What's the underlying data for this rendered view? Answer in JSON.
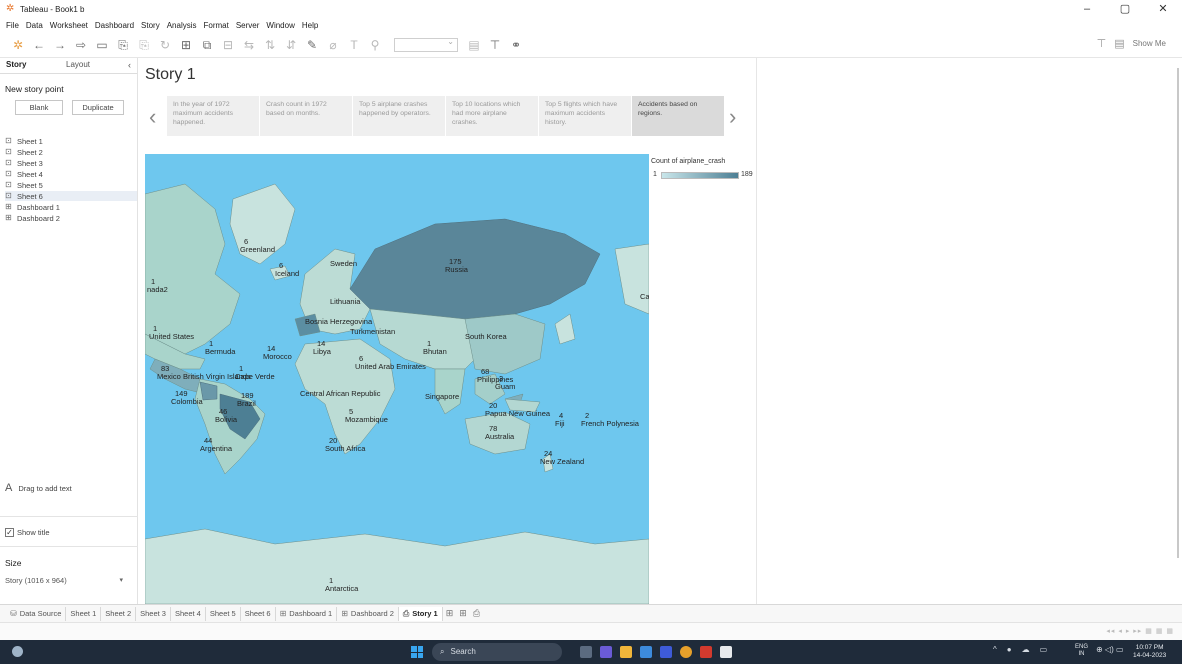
{
  "window": {
    "title": "Tableau - Book1 b",
    "controls": [
      "–",
      "▢",
      "✕"
    ]
  },
  "menu": [
    "File",
    "Data",
    "Worksheet",
    "Dashboard",
    "Story",
    "Analysis",
    "Format",
    "Server",
    "Window",
    "Help"
  ],
  "toolbar": {
    "show_me": "Show Me"
  },
  "left_panel": {
    "tabs": [
      "Story",
      "Layout"
    ],
    "new_story_point": "New story point",
    "blank_button": "Blank",
    "duplicate_button": "Duplicate",
    "sheets": [
      "Sheet 1",
      "Sheet 2",
      "Sheet 3",
      "Sheet 4",
      "Sheet 5",
      "Sheet 6",
      "Dashboard 1",
      "Dashboard 2"
    ],
    "drag_text": "Drag to add text",
    "show_title": "Show title",
    "size_heading": "Size",
    "size_value": "Story (1016 x 964)"
  },
  "story": {
    "title": "Story 1",
    "points": [
      "In the year of 1972 maximum accidents happened.",
      "Crash count in 1972 based on months.",
      "Top 5 airplane crashes happened by operators.",
      "Top 10 locations which had more airplane crashes.",
      "Top 5 flights which have maximum accidents history.",
      "Accidents based on regions."
    ],
    "active_point": 5
  },
  "legend": {
    "title": "Count of airplane_crash",
    "min": "1",
    "max": "189",
    "color_low": "#c9e6ea",
    "color_high": "#4d7f94"
  },
  "map_labels": [
    {
      "name": "Greenland",
      "count": "6"
    },
    {
      "name": "Iceland",
      "count": "6"
    },
    {
      "name": "Sweden",
      "count": ""
    },
    {
      "name": "Russia",
      "count": "175"
    },
    {
      "name": "nada2",
      "count": "1"
    },
    {
      "name": "Lithuania",
      "count": ""
    },
    {
      "name": "Bosnia Herzegovina",
      "count": ""
    },
    {
      "name": "Turkmenistan",
      "count": ""
    },
    {
      "name": "South Korea",
      "count": ""
    },
    {
      "name": "United States",
      "count": "1"
    },
    {
      "name": "Bermuda",
      "count": "1"
    },
    {
      "name": "Morocco",
      "count": "14"
    },
    {
      "name": "Libya",
      "count": "14"
    },
    {
      "name": "United Arab Emirates",
      "count": "6"
    },
    {
      "name": "Bhutan",
      "count": "1"
    },
    {
      "name": "Mexico",
      "count": "83"
    },
    {
      "name": "British Virgin Islands",
      "count": ""
    },
    {
      "name": "Cape Verde",
      "count": "1"
    },
    {
      "name": "Philippines",
      "count": "68"
    },
    {
      "name": "Guam",
      "count": "3"
    },
    {
      "name": "Colombia",
      "count": "149"
    },
    {
      "name": "Central African Republic",
      "count": ""
    },
    {
      "name": "Singapore",
      "count": ""
    },
    {
      "name": "Papua New Guinea",
      "count": "20"
    },
    {
      "name": "Brazil",
      "count": "189"
    },
    {
      "name": "Bolivia",
      "count": "46"
    },
    {
      "name": "Mozambique",
      "count": "5"
    },
    {
      "name": "Fiji",
      "count": "4"
    },
    {
      "name": "French Polynesia",
      "count": "2"
    },
    {
      "name": "Australia",
      "count": "78"
    },
    {
      "name": "Argentina",
      "count": "44"
    },
    {
      "name": "South Africa",
      "count": "20"
    },
    {
      "name": "New Zealand",
      "count": "24"
    },
    {
      "name": "Antarctica",
      "count": "1"
    },
    {
      "name": "Ca",
      "count": ""
    }
  ],
  "bottom_tabs": [
    "Data Source",
    "Sheet 1",
    "Sheet 2",
    "Sheet 3",
    "Sheet 4",
    "Sheet 5",
    "Sheet 6",
    "Dashboard 1",
    "Dashboard 2",
    "Story 1"
  ],
  "taskbar": {
    "search": "Search",
    "lang_line1": "ENG",
    "lang_line2": "IN",
    "time": "10:07 PM",
    "date": "14-04-2023"
  }
}
